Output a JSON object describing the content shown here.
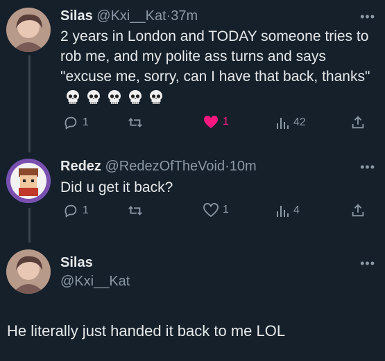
{
  "tweet1": {
    "name": "Silas",
    "handle": "@Kxi__Kat",
    "sep": "·",
    "time": "37m",
    "text": "2 years in London and TODAY someone tries to rob me, and my polite ass turns and says \"excuse me, sorry, can I have that back, thanks\"",
    "emoji_count": 5,
    "emoji": "skull-icon",
    "replies": "1",
    "likes": "1",
    "views": "42",
    "liked": true
  },
  "tweet2": {
    "name": "Redez",
    "handle": "@RedezOfTheVoid",
    "sep": "·",
    "time": "10m",
    "text": "Did u get it back?",
    "replies": "1",
    "likes": "1",
    "views": "4"
  },
  "tweet3": {
    "name": "Silas",
    "handle": "@Kxi__Kat",
    "text": "He literally just handed it back to me LOL"
  },
  "more_label": "•••",
  "colors": {
    "background": "#15202b",
    "text": "#e7e9ea",
    "muted": "#8b98a5",
    "like": "#f91880",
    "line": "#38444d"
  }
}
